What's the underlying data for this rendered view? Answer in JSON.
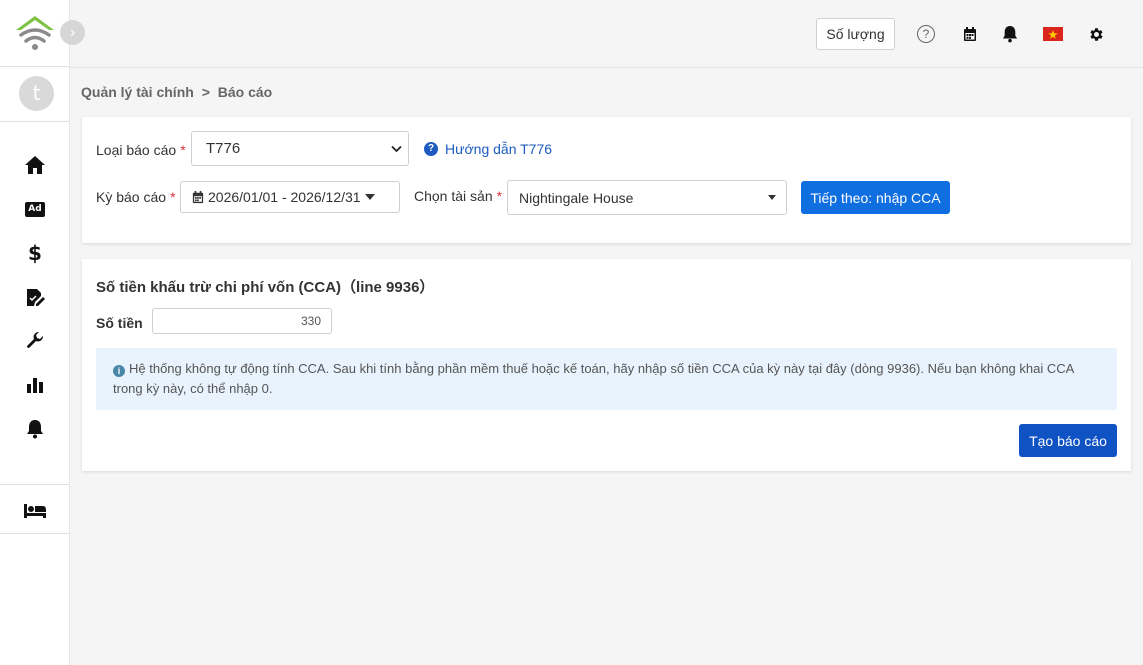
{
  "sidebar": {
    "avatar_initial": "t",
    "collapse_glyph": "›",
    "items": [
      {
        "name": "home",
        "icon": "home-icon"
      },
      {
        "name": "ads",
        "icon": "ad-icon",
        "label": "Ad"
      },
      {
        "name": "finance",
        "icon": "dollar-icon",
        "label": "$"
      },
      {
        "name": "edit",
        "icon": "edit-document-icon"
      },
      {
        "name": "tools",
        "icon": "wrench-icon"
      },
      {
        "name": "reports",
        "icon": "bar-chart-icon"
      },
      {
        "name": "notifications",
        "icon": "bell-icon"
      },
      {
        "name": "rooms",
        "icon": "bed-icon"
      }
    ]
  },
  "topbar": {
    "quantity_label": "Số lượng",
    "help_glyph": "?",
    "icons": [
      "help-icon",
      "calendar-icon",
      "bell-icon",
      "vietnam-flag-icon",
      "gear-icon"
    ]
  },
  "breadcrumb": {
    "parent": "Quản lý tài chính",
    "separator": ">",
    "current": "Báo cáo"
  },
  "form": {
    "report_type_label": "Loại báo cáo",
    "report_type_value": "T776",
    "guide_link": "Hướng dẫn T776",
    "period_label": "Kỳ báo cáo",
    "period_value": "2026/01/01 - 2026/12/31",
    "asset_label": "Chọn tài sản",
    "asset_value": "Nightingale House",
    "next_button": "Tiếp theo: nhập CCA",
    "required_mark": "*"
  },
  "cca": {
    "title": "Số tiền khấu trừ chi phí vốn (CCA)（line 9936）",
    "amount_label": "Số tiền",
    "amount_value": "330",
    "info_text": "Hệ thống không tự động tính CCA. Sau khi tính bằng phần mềm thuế hoặc kế toán, hãy nhập số tiền CCA của kỳ này tại đây (dòng 9936). Nếu bạn không khai CCA trong kỳ này, có thể nhập 0.",
    "submit_button": "Tạo báo cáo"
  },
  "colors": {
    "primary": "#0f6fe0",
    "submit": "#0f52c4",
    "link": "#1d5bbf",
    "required": "#d9343b",
    "info_bg": "#e9f3fd",
    "logo_green": "#7dc243"
  }
}
